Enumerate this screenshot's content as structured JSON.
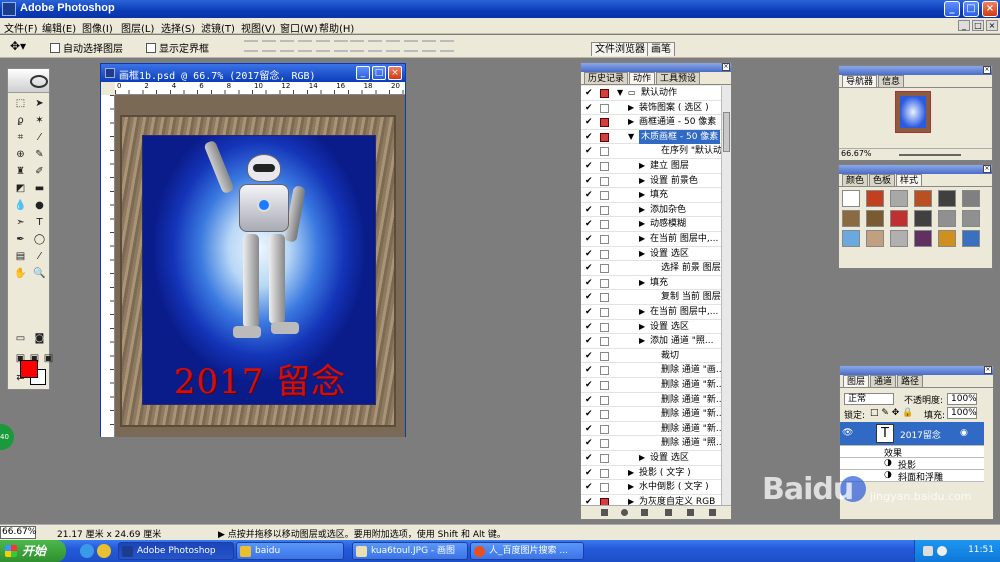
{
  "app": {
    "title": "Adobe Photoshop",
    "menu": [
      "文件(F)",
      "编辑(E)",
      "图像(I)",
      "图层(L)",
      "选择(S)",
      "滤镜(T)",
      "视图(V)",
      "窗口(W)",
      "帮助(H)"
    ]
  },
  "options": {
    "auto_select": "自动选择图层",
    "show_bounds": "显示定界框",
    "tab_file_browser": "文件浏览器",
    "tab_brushes": "画笔"
  },
  "document": {
    "title": "画框1b.psd @ 66.7% (2017留念, RGB)",
    "caption": "2017 留念",
    "ruler_numbers": [
      "0",
      "2",
      "4",
      "6",
      "8",
      "10",
      "12",
      "14",
      "16",
      "18",
      "20"
    ]
  },
  "actions_panel": {
    "tabs": [
      "历史记录",
      "动作",
      "工具预设"
    ],
    "rows": [
      {
        "label": "默认动作",
        "indent": 0,
        "expanded": true,
        "folder": true
      },
      {
        "label": "装饰图案 ( 选区 )",
        "indent": 1,
        "expanded": false
      },
      {
        "label": "画框通道 - 50 像素",
        "indent": 1,
        "expanded": false
      },
      {
        "label": "木质画框 - 50 像素",
        "indent": 1,
        "expanded": true,
        "selected": true
      },
      {
        "label": "在序列 \"默认动...",
        "indent": 3
      },
      {
        "label": "建立 图层",
        "indent": 2,
        "expanded": false
      },
      {
        "label": "设置 前景色",
        "indent": 2,
        "expanded": false
      },
      {
        "label": "填充",
        "indent": 2,
        "expanded": false
      },
      {
        "label": "添加杂色",
        "indent": 2,
        "expanded": false
      },
      {
        "label": "动感模糊",
        "indent": 2,
        "expanded": false
      },
      {
        "label": "在当前 图层中,...",
        "indent": 2,
        "expanded": false
      },
      {
        "label": "设置 选区",
        "indent": 2,
        "expanded": false
      },
      {
        "label": "选择 前景 图层",
        "indent": 3
      },
      {
        "label": "填充",
        "indent": 2,
        "expanded": false
      },
      {
        "label": "复制 当前 图层",
        "indent": 3
      },
      {
        "label": "在当前 图层中,...",
        "indent": 2,
        "expanded": false
      },
      {
        "label": "设置 选区",
        "indent": 2,
        "expanded": false
      },
      {
        "label": "添加 通道 \"照...",
        "indent": 2,
        "expanded": false
      },
      {
        "label": "裁切",
        "indent": 3
      },
      {
        "label": "删除 通道 \"画...",
        "indent": 3
      },
      {
        "label": "删除 通道 \"新...",
        "indent": 3
      },
      {
        "label": "删除 通道 \"新...",
        "indent": 3
      },
      {
        "label": "删除 通道 \"新...",
        "indent": 3
      },
      {
        "label": "删除 通道 \"新...",
        "indent": 3
      },
      {
        "label": "删除 通道 \"照...",
        "indent": 3
      },
      {
        "label": "设置 选区",
        "indent": 2,
        "expanded": false
      },
      {
        "label": "投影 ( 文字 )",
        "indent": 1,
        "expanded": false
      },
      {
        "label": "水中倒影 ( 文字 )",
        "indent": 1,
        "expanded": false
      },
      {
        "label": "为灰度自定义 RGB",
        "indent": 1,
        "expanded": false
      }
    ]
  },
  "navigator": {
    "tabs": [
      "导航器",
      "信息"
    ],
    "zoom": "66.67%"
  },
  "styles_panel": {
    "tabs": [
      "颜色",
      "色板",
      "样式"
    ],
    "swatches": [
      "#ffffff",
      "#c04020",
      "#a8a8a8",
      "#b85020",
      "#404040",
      "#808080",
      "#8a6a40",
      "#7a5a30",
      "#c03030",
      "#404040",
      "#909090",
      "#909090",
      "#6aa8e0",
      "#c0a080",
      "#b0b0b0",
      "#603060",
      "#d09020",
      "#3a70c0"
    ]
  },
  "layers_panel": {
    "tabs": [
      "图层",
      "通道",
      "路径"
    ],
    "blend_mode": "正常",
    "opacity_label": "不透明度:",
    "opacity": "100%",
    "lock_label": "锁定:",
    "fill_label": "填充:",
    "fill": "100%",
    "layer_name": "2017留念",
    "effects_label": "效果",
    "effects": [
      "投影",
      "斜面和浮雕"
    ]
  },
  "status": {
    "zoom": "66.67%",
    "doc_size": "21.17 厘米 x 24.69 厘米",
    "hint": "点按并拖移以移动图层或选区。要用附加选项，使用 Shift 和 Alt 键。"
  },
  "taskbar": {
    "start": "开始",
    "items": [
      "Adobe Photoshop",
      "baidu",
      "kua6toul.JPG - 画图",
      "人_百度图片搜索 ..."
    ],
    "clock": "11:51"
  },
  "side_badge": "40",
  "watermark": {
    "brand": "Baidu",
    "sub": "jingyan.baidu.com"
  }
}
